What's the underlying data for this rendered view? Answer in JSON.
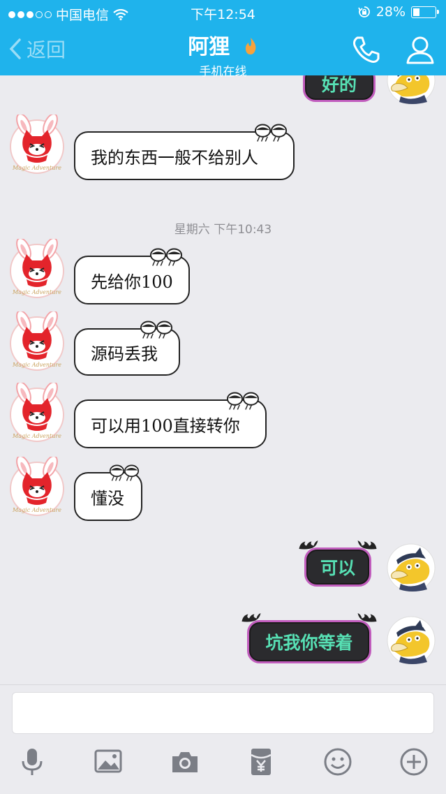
{
  "status_bar": {
    "carrier": "中国电信",
    "time": "下午12:54",
    "battery": "28%"
  },
  "header": {
    "back_label": "返回",
    "contact_name": "阿狸",
    "contact_status": "手机在线"
  },
  "chat": {
    "timestamp": "星期六 下午10:43",
    "messages": [
      {
        "side": "right",
        "text": "好的"
      },
      {
        "side": "left",
        "text": "我的东西一般不给别人"
      },
      {
        "side": "left",
        "text": "先给你100"
      },
      {
        "side": "left",
        "text": "源码丢我"
      },
      {
        "side": "left",
        "text": "可以用100直接转你"
      },
      {
        "side": "left",
        "text": "懂没"
      },
      {
        "side": "right",
        "text": "可以"
      },
      {
        "side": "right",
        "text": "坑我你等着"
      }
    ],
    "avatar_left_caption": "Magic Adventure"
  },
  "input": {
    "placeholder": ""
  },
  "toolbar": {
    "icons": [
      "microphone-icon",
      "image-icon",
      "camera-icon",
      "red-packet-icon",
      "emoji-icon",
      "plus-icon"
    ]
  },
  "colors": {
    "header_bg": "#1fb3ec",
    "chat_bg": "#ebebef",
    "dark_bubble_text": "#57e0b4",
    "dark_bubble_border": "#c15dbd"
  }
}
